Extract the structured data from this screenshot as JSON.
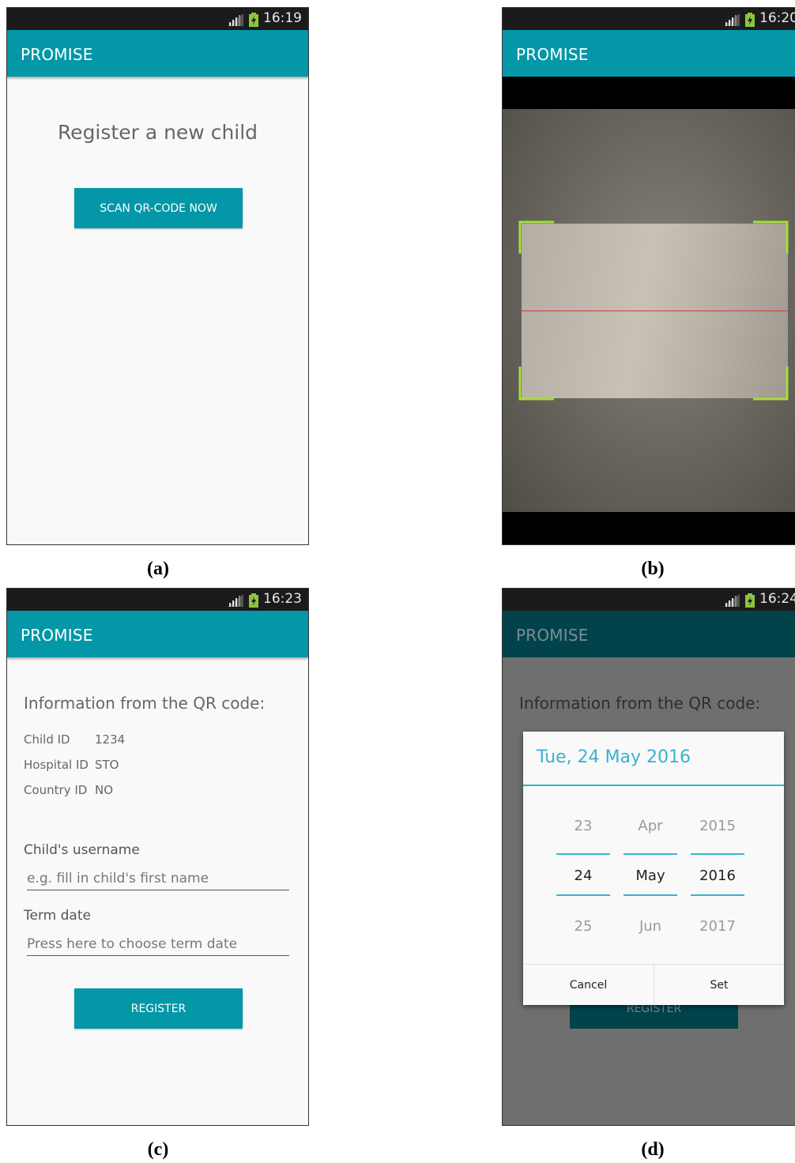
{
  "screens": {
    "a": {
      "caption": "(a)",
      "status_time": "16:19",
      "app_title": "PROMISE",
      "heading": "Register a new child",
      "scan_button": "SCAN QR-CODE NOW"
    },
    "b": {
      "caption": "(b)",
      "status_time": "16:20",
      "app_title": "PROMISE"
    },
    "c": {
      "caption": "(c)",
      "status_time": "16:23",
      "app_title": "PROMISE",
      "heading": "Information from the QR code:",
      "info": [
        {
          "label": "Child ID",
          "value": "1234"
        },
        {
          "label": "Hospital ID",
          "value": "STO"
        },
        {
          "label": "Country ID",
          "value": "NO"
        }
      ],
      "username_label": "Child's username",
      "username_placeholder": "e.g. fill in child's first name",
      "term_label": "Term date",
      "term_placeholder": "Press here to choose term date",
      "register_button": "REGISTER"
    },
    "d": {
      "caption": "(d)",
      "status_time": "16:24",
      "app_title": "PROMISE",
      "heading": "Information from the QR code:",
      "register_button": "REGISTER",
      "dialog": {
        "title": "Tue, 24 May 2016",
        "day": {
          "prev": "23",
          "selected": "24",
          "next": "25"
        },
        "month": {
          "prev": "Apr",
          "selected": "May",
          "next": "Jun"
        },
        "year": {
          "prev": "2015",
          "selected": "2016",
          "next": "2017"
        },
        "cancel": "Cancel",
        "set": "Set"
      }
    }
  },
  "colors": {
    "app_bar": "#0397a7",
    "accent": "#37b4cf",
    "scanner_corner": "#a4e03a",
    "scanner_line": "#d43a3a"
  }
}
